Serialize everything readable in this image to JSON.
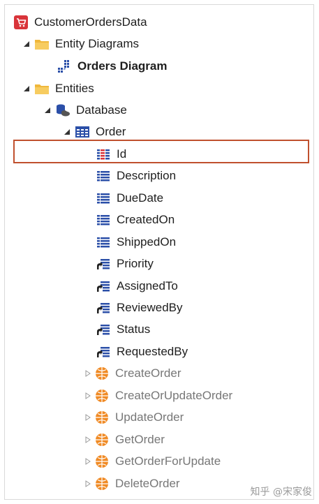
{
  "tree": {
    "root": {
      "label": "CustomerOrdersData",
      "icon": "cart-icon",
      "color": "#d9343a"
    },
    "entity_diagrams": {
      "label": "Entity Diagrams",
      "icon": "folder-icon"
    },
    "orders_diagram": {
      "label": "Orders Diagram",
      "icon": "diagram-icon"
    },
    "entities": {
      "label": "Entities",
      "icon": "folder-icon"
    },
    "database": {
      "label": "Database",
      "icon": "database-icon"
    },
    "order": {
      "label": "Order",
      "icon": "table-icon"
    },
    "attributes": [
      {
        "label": "Id",
        "icon": "primary-key-icon",
        "selected": true
      },
      {
        "label": "Description",
        "icon": "attribute-icon"
      },
      {
        "label": "DueDate",
        "icon": "attribute-icon"
      },
      {
        "label": "CreatedOn",
        "icon": "attribute-icon"
      },
      {
        "label": "ShippedOn",
        "icon": "attribute-icon"
      },
      {
        "label": "Priority",
        "icon": "reference-attribute-icon"
      },
      {
        "label": "AssignedTo",
        "icon": "reference-attribute-icon"
      },
      {
        "label": "ReviewedBy",
        "icon": "reference-attribute-icon"
      },
      {
        "label": "Status",
        "icon": "reference-attribute-icon"
      },
      {
        "label": "RequestedBy",
        "icon": "reference-attribute-icon"
      }
    ],
    "actions": [
      {
        "label": "CreateOrder",
        "icon": "entity-action-icon"
      },
      {
        "label": "CreateOrUpdateOrder",
        "icon": "entity-action-icon"
      },
      {
        "label": "UpdateOrder",
        "icon": "entity-action-icon"
      },
      {
        "label": "GetOrder",
        "icon": "entity-action-icon"
      },
      {
        "label": "GetOrderForUpdate",
        "icon": "entity-action-icon"
      },
      {
        "label": "DeleteOrder",
        "icon": "entity-action-icon"
      }
    ]
  },
  "watermark": "知乎 @宋家俊",
  "colors": {
    "folder": "#f0b83c",
    "table_blue": "#2b4fa8",
    "primary_key_red": "#d9343a",
    "action_orange": "#f08a24",
    "selection_border": "#c0502e"
  }
}
